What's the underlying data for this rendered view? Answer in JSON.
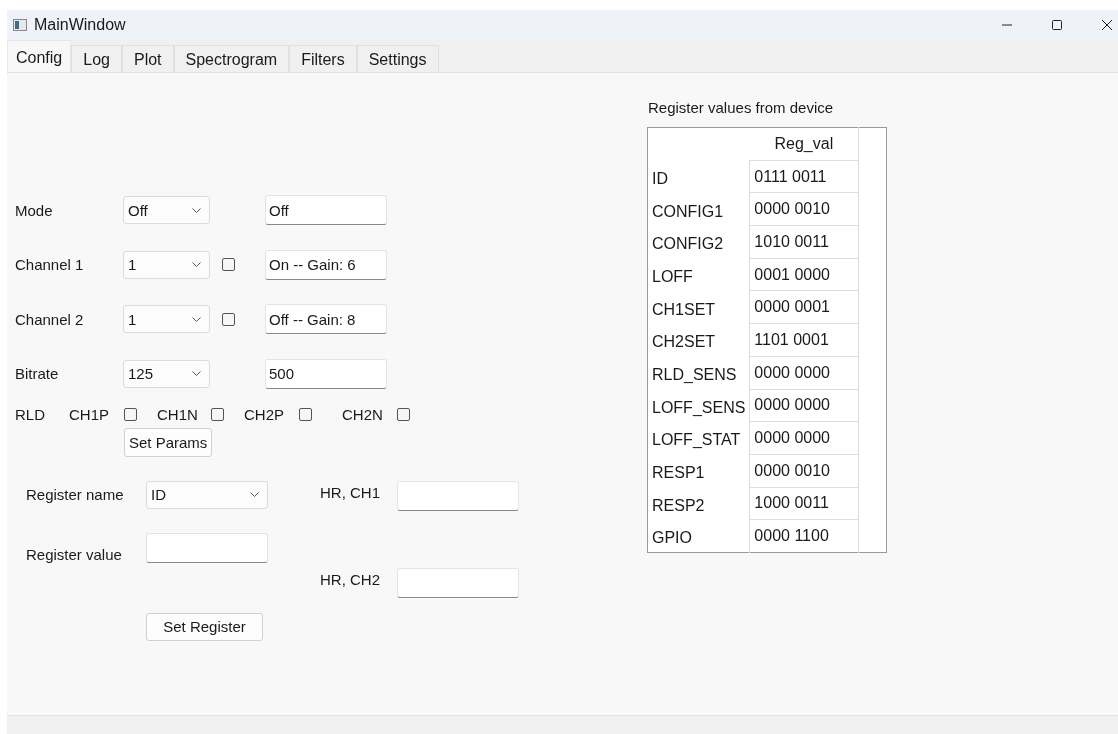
{
  "window": {
    "title": "MainWindow"
  },
  "tabs": [
    {
      "label": "Config",
      "selected": true
    },
    {
      "label": "Log",
      "selected": false
    },
    {
      "label": "Plot",
      "selected": false
    },
    {
      "label": "Spectrogram",
      "selected": false
    },
    {
      "label": "Filters",
      "selected": false
    },
    {
      "label": "Settings",
      "selected": false
    }
  ],
  "settings": [
    {
      "kind": "setting",
      "label": "Mode",
      "combo": "Off",
      "field": "Off"
    },
    {
      "kind": "channel",
      "label": "Channel 1",
      "combo": "1",
      "checked": false,
      "field": "On -- Gain: 6"
    },
    {
      "kind": "channel",
      "label": "Channel 2",
      "combo": "1",
      "checked": false,
      "field": "Off -- Gain: 8"
    },
    {
      "kind": "setting",
      "label": "Bitrate",
      "combo": "125",
      "field": "500"
    }
  ],
  "rld": {
    "label": "RLD",
    "options": [
      {
        "label": "CH1P",
        "checked": false
      },
      {
        "label": "CH1N",
        "checked": false
      },
      {
        "label": "CH2P",
        "checked": false
      },
      {
        "label": "CH2N",
        "checked": false
      }
    ]
  },
  "set_params_button": "Set Params",
  "register": {
    "name_label": "Register name",
    "name_combo": "ID",
    "value_label": "Register value",
    "set_button": "Set Register"
  },
  "heart_rate": [
    {
      "label": "HR, CH1"
    },
    {
      "label": "HR, CH2"
    }
  ],
  "register_table": {
    "title": "Register values from device",
    "columns": [
      "Reg_val"
    ],
    "rows": [
      {
        "name": "ID",
        "value": "0111 0011"
      },
      {
        "name": "CONFIG1",
        "value": "0000 0010"
      },
      {
        "name": "CONFIG2",
        "value": "1010 0011"
      },
      {
        "name": "LOFF",
        "value": "0001 0000"
      },
      {
        "name": "CH1SET",
        "value": "0000 0001"
      },
      {
        "name": "CH2SET",
        "value": "1101 0001"
      },
      {
        "name": "RLD_SENS",
        "value": "0000 0000"
      },
      {
        "name": "LOFF_SENS",
        "value": "0000 0000"
      },
      {
        "name": "LOFF_STAT",
        "value": "0000 0000"
      },
      {
        "name": "RESP1",
        "value": "0000 0010"
      },
      {
        "name": "RESP2",
        "value": "1000 0011"
      },
      {
        "name": "GPIO",
        "value": "0000 1100"
      }
    ]
  }
}
